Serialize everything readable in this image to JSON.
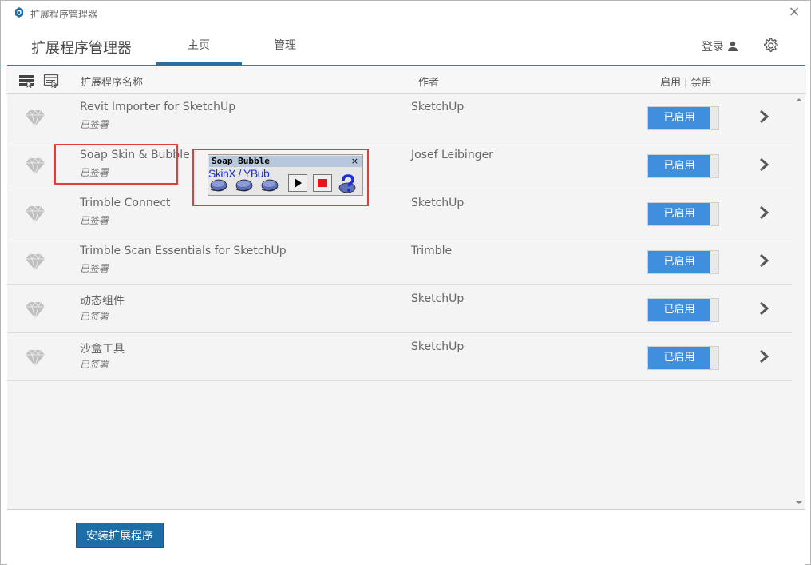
{
  "window": {
    "title": "扩展程序管理器",
    "close_glyph": "×"
  },
  "header": {
    "app_title": "扩展程序管理器",
    "tabs": [
      {
        "label": "主页"
      },
      {
        "label": "管理"
      }
    ],
    "login_label": "登录",
    "icons": [
      "user-icon",
      "gear-icon"
    ]
  },
  "columns": {
    "name": "扩展程序名称",
    "author": "作者",
    "enable": "启用 | 禁用"
  },
  "extensions": [
    {
      "name": "Revit Importer for SketchUp",
      "signed": "已签署",
      "author": "SketchUp",
      "status": "已启用"
    },
    {
      "name": "Soap Skin & Bubble",
      "signed": "已签署",
      "author": "Josef Leibinger",
      "status": "已启用"
    },
    {
      "name": "Trimble Connect",
      "signed": "已签署",
      "author": "SketchUp",
      "status": "已启用"
    },
    {
      "name": "Trimble Scan Essentials for SketchUp",
      "signed": "已签署",
      "author": "Trimble",
      "status": "已启用"
    },
    {
      "name": "动态组件",
      "signed": "已签署",
      "author": "SketchUp",
      "status": "已启用"
    },
    {
      "name": "沙盒工具",
      "signed": "已签署",
      "author": "SketchUp",
      "status": "已启用"
    }
  ],
  "floating_toolbar": {
    "title": "Soap Bubble",
    "close_glyph": "×",
    "label": "SkinX / YBub"
  },
  "footer": {
    "install_label": "安装扩展程序"
  },
  "colors": {
    "accent": "#2a6fa3",
    "toggle_on": "#3f8fde",
    "highlight": "#e8393b"
  }
}
